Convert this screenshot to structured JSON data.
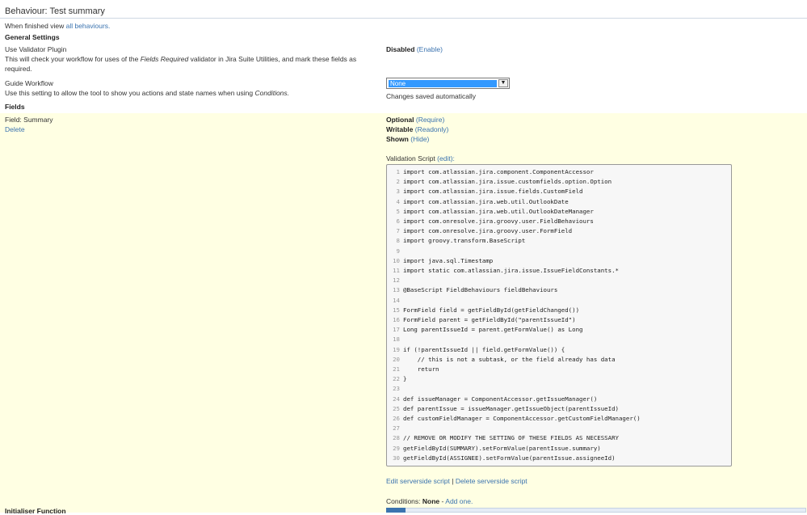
{
  "header": {
    "title": "Behaviour: Test summary",
    "finished_prefix": "When finished view",
    "finished_link": "all behaviours."
  },
  "general": {
    "heading": "General Settings",
    "validator": {
      "label": "Use Validator Plugin",
      "desc_1": "This will check your workflow for uses of the",
      "desc_em": "Fields Required",
      "desc_2": "validator in Jira Suite Utilities, and mark these fields as",
      "desc_3": "required.",
      "status": "Disabled",
      "action": "(Enable)"
    },
    "guide": {
      "label": "Guide Workflow",
      "desc_1": "Use this setting to allow the tool to show you actions and state names when using",
      "desc_em": "Conditions.",
      "selected": "None",
      "saved_note": "Changes saved automatically"
    }
  },
  "fields": {
    "heading": "Fields",
    "field_label": "Field: Summary",
    "delete_link": "Delete",
    "optional": "Optional",
    "require_link": "(Require)",
    "writable": "Writable",
    "readonly_link": "(Readonly)",
    "shown": "Shown",
    "hide_link": "(Hide)",
    "validation_label": "Validation Script",
    "edit_link": "(edit):",
    "edit_serverside": "Edit serverside script",
    "separator": "|",
    "delete_serverside": "Delete serverside script",
    "conditions_label": "Conditions:",
    "conditions_value": "None",
    "conditions_dash": "-",
    "add_one": "Add one.",
    "initialiser_label": "Initialiser Function"
  },
  "code": {
    "lines": [
      "import com.atlassian.jira.component.ComponentAccessor",
      "import com.atlassian.jira.issue.customfields.option.Option",
      "import com.atlassian.jira.issue.fields.CustomField",
      "import com.atlassian.jira.web.util.OutlookDate",
      "import com.atlassian.jira.web.util.OutlookDateManager",
      "import com.onresolve.jira.groovy.user.FieldBehaviours",
      "import com.onresolve.jira.groovy.user.FormField",
      "import groovy.transform.BaseScript",
      "",
      "import java.sql.Timestamp",
      "import static com.atlassian.jira.issue.IssueFieldConstants.*",
      "",
      "@BaseScript FieldBehaviours fieldBehaviours",
      "",
      "FormField field = getFieldById(getFieldChanged())",
      "FormField parent = getFieldById(\"parentIssueId\")",
      "Long parentIssueId = parent.getFormValue() as Long",
      "",
      "if (!parentIssueId || field.getFormValue()) {",
      "    // this is not a subtask, or the field already has data",
      "    return",
      "}",
      "",
      "def issueManager = ComponentAccessor.getIssueManager()",
      "def parentIssue = issueManager.getIssueObject(parentIssueId)",
      "def customFieldManager = ComponentAccessor.getCustomFieldManager()",
      "",
      "// REMOVE OR MODIFY THE SETTING OF THESE FIELDS AS NECESSARY",
      "getFieldById(SUMMARY).setFormValue(parentIssue.summary)",
      "getFieldById(ASSIGNEE).setFormValue(parentIssue.assigneeId)"
    ]
  },
  "colors": {
    "link": "#3b73af",
    "fields_band": "#ffffe3",
    "selection": "#3399ff"
  }
}
